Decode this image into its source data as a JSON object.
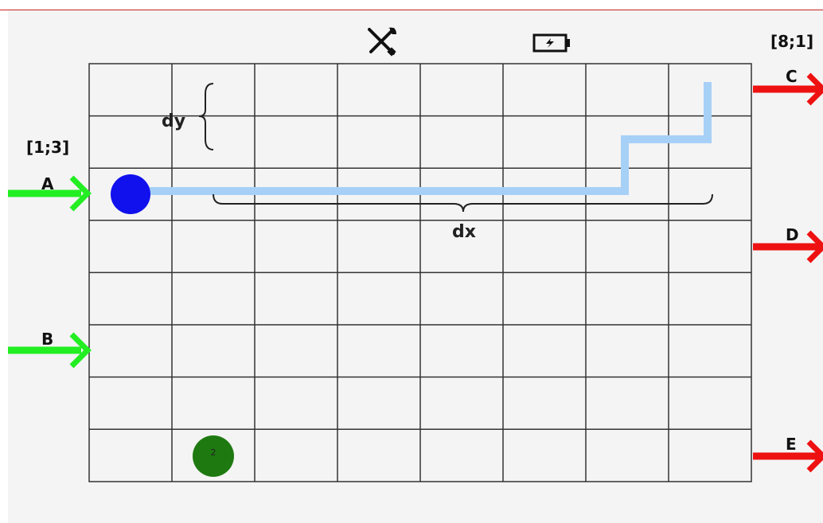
{
  "header": {
    "tools_icon": "tools-icon",
    "battery_icon": "battery-charging-icon"
  },
  "coords": {
    "start": "[1;3]",
    "end": "[8;1]"
  },
  "inputs": [
    {
      "label": "A",
      "color": "#22ee22"
    },
    {
      "label": "B",
      "color": "#22ee22"
    }
  ],
  "outputs": [
    {
      "label": "C",
      "color": "#ee1111"
    },
    {
      "label": "D",
      "color": "#ee1111"
    },
    {
      "label": "E",
      "color": "#ee1111"
    }
  ],
  "dimensions": {
    "dx": "dx",
    "dy": "dy"
  },
  "grid": {
    "columns": 8,
    "rows": 8
  },
  "robot": {
    "color": "#1111ee",
    "cell": [
      1,
      3
    ]
  },
  "stop": {
    "label": "2",
    "color": "#1e7a10",
    "cell": [
      2,
      8
    ]
  },
  "path": {
    "color": "#a7d0f7"
  }
}
